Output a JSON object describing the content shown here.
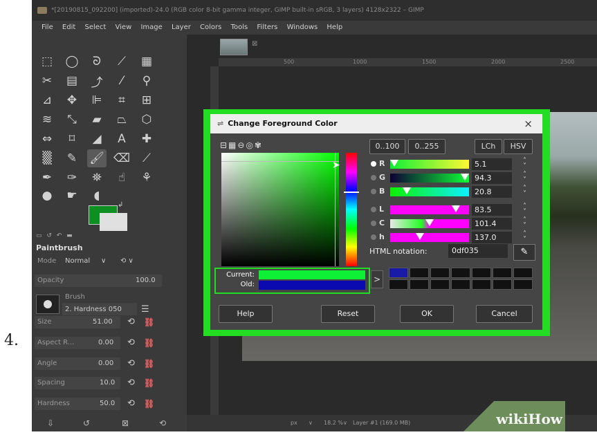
{
  "step_number": "4.",
  "window": {
    "title": "*[20190815_092200] (imported)-24.0 (RGB color 8-bit gamma integer, GIMP built-in sRGB, 3 layers) 4128x2322 – GIMP"
  },
  "menubar": [
    "File",
    "Edit",
    "Select",
    "View",
    "Image",
    "Layer",
    "Colors",
    "Tools",
    "Filters",
    "Windows",
    "Help"
  ],
  "toolbox": {
    "fg_color": "#0d8f22",
    "bg_color": "#e0e0e0",
    "dock_title": "Paintbrush",
    "mode_label": "Mode",
    "mode_value": "Normal",
    "opacity_label": "Opacity",
    "opacity_value": "100.0",
    "brush_label": "Brush",
    "brush_value": "2. Hardness 050",
    "options": [
      {
        "label": "Size",
        "value": "51.00"
      },
      {
        "label": "Aspect R...",
        "value": "0.00"
      },
      {
        "label": "Angle",
        "value": "0.00"
      },
      {
        "label": "Spacing",
        "value": "10.0"
      },
      {
        "label": "Hardness",
        "value": "50.0"
      }
    ]
  },
  "ruler": {
    "ticks": [
      "500",
      "1000",
      "1500",
      "2000",
      "2500"
    ]
  },
  "statusbar": {
    "unit": "px",
    "zoom": "18.2 %",
    "layer": "Layer #1 (169.0 MB)"
  },
  "watermark": {
    "wiki": "wiki",
    "how": "How"
  },
  "dialog": {
    "title": "Change Foreground Color",
    "close": "×",
    "range_buttons": [
      "0..100",
      "0..255"
    ],
    "model_buttons": [
      "LCh",
      "HSV"
    ],
    "channels": [
      {
        "label": "R",
        "value": "5.1",
        "fill": 0.05,
        "gradient": "linear-gradient(to right,#0df035,#fff835)",
        "active": true
      },
      {
        "label": "G",
        "value": "94.3",
        "fill": 0.943,
        "gradient": "linear-gradient(to right,#0d0035,#0dff35)",
        "active": false
      },
      {
        "label": "B",
        "value": "20.8",
        "fill": 0.208,
        "gradient": "linear-gradient(to right,#0df000,#0df0ff)",
        "active": false
      },
      {
        "label": "L",
        "value": "83.5",
        "fill": 0.835,
        "gradient": "linear-gradient(to right,#ff00ff,#ff00ff)",
        "active": false
      },
      {
        "label": "C",
        "value": "101.4",
        "fill": 0.5,
        "gradient": "linear-gradient(to right,#e8e8e8,#22ff22 40%,#ff00ff 50%,#ff00ff)",
        "active": false
      },
      {
        "label": "h",
        "value": "137.0",
        "fill": 0.38,
        "gradient": "linear-gradient(to right,#ff00ff,#ff00ff)",
        "active": false
      }
    ],
    "html_label": "HTML notation:",
    "html_value": "0df035",
    "current_label": "Current:",
    "old_label": "Old:",
    "current_color": "#0df035",
    "old_color": "#0a0ab0",
    "history_colors": [
      "#1a1aa8",
      "#111111",
      "#111111",
      "#111111",
      "#111111",
      "#111111",
      "#111111",
      "#111111",
      "#111111",
      "#111111",
      "#111111",
      "#111111",
      "#111111",
      "#111111"
    ],
    "buttons": {
      "help": "Help",
      "reset": "Reset",
      "ok": "OK",
      "cancel": "Cancel"
    },
    "highlight_color": "#22dd22"
  }
}
